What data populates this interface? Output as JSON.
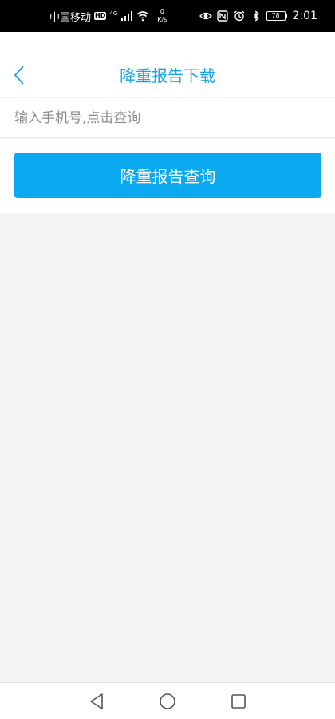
{
  "status_bar": {
    "carrier": "中国移动",
    "hd": "HD",
    "network": "4G",
    "speed_value": "0",
    "speed_unit": "K/s",
    "battery": "78",
    "time": "2:01"
  },
  "header": {
    "title": "降重报告下载",
    "back_icon": "chevron-left-icon",
    "accent_color": "#1aa3e8"
  },
  "search": {
    "placeholder": "输入手机号,点击查询",
    "value": ""
  },
  "actions": {
    "query_label": "降重报告查询",
    "button_color": "#0ba9f0"
  },
  "nav_bar": {
    "icons": [
      "back-triangle-icon",
      "home-circle-icon",
      "recents-square-icon"
    ]
  }
}
